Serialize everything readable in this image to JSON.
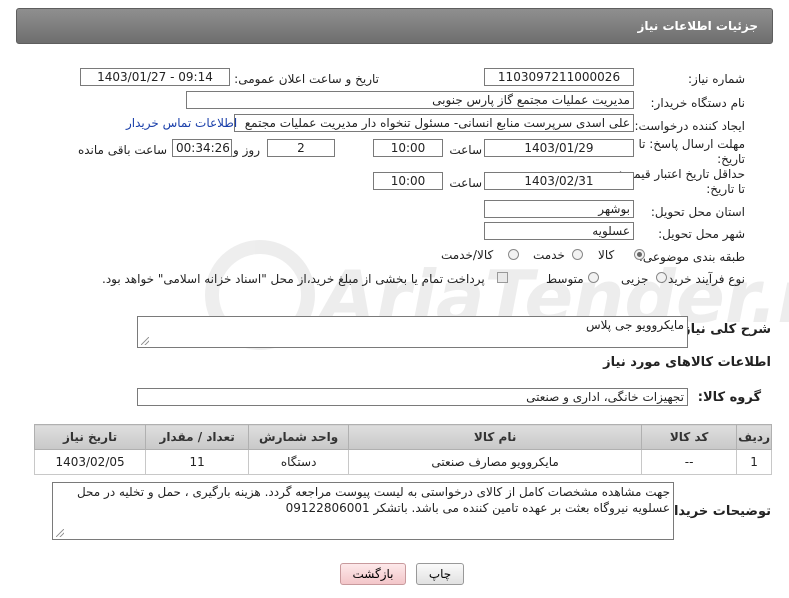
{
  "header": {
    "title": "جزئیات اطلاعات نیاز"
  },
  "form": {
    "need_number_label": "شماره نیاز:",
    "need_number": "1103097211000026",
    "announce_label": "تاریخ و ساعت اعلان عمومی:",
    "announce_value": "1403/01/27 - 09:14",
    "buyer_label": "نام دستگاه خریدار:",
    "buyer_value": "مدیریت عملیات مجتمع گاز پارس جنوبی",
    "creator_label": "ایجاد کننده درخواست:",
    "creator_value": "علی اسدی سرپرست منابع انسانی- مسئول تنخواه دار  مدیریت عملیات مجتمع",
    "contact_link": "اطلاعات تماس خریدار",
    "reply_deadline_label": "مهلت ارسال پاسخ: تا تاریخ:",
    "reply_date": "1403/01/29",
    "time_label": "ساعت",
    "reply_time": "10:00",
    "days_value": "2",
    "days_label": "روز و",
    "remaining_time": "00:34:26",
    "remaining_label": "ساعت باقی مانده",
    "price_validity_label": "حداقل تاریخ اعتبار قیمت: تا تاریخ:",
    "price_date": "1403/02/31",
    "price_time": "10:00",
    "province_label": "استان محل تحویل:",
    "province_value": "بوشهر",
    "city_label": "شهر محل تحویل:",
    "city_value": "عسلویه",
    "category_label": "طبقه بندی موضوعی:",
    "category_options": [
      "کالا",
      "خدمت",
      "کالا/خدمت"
    ],
    "category_selected": "کالا",
    "process_label": "نوع فرآیند خرید :",
    "process_options": [
      "جزیی",
      "متوسط"
    ],
    "process_selected": "جزیی",
    "payment_note": "پرداخت تمام یا بخشی از مبلغ خرید،از محل \"اسناد خزانه اسلامی\" خواهد بود.",
    "description_label": "شرح کلی نیاز:",
    "description_value": "مایکروویو جی پلاس",
    "goods_info_title": "اطلاعات کالاهای مورد نیاز",
    "goods_group_label": "گروه کالا:",
    "goods_group_value": "تجهیزات خانگی، اداری و صنعتی"
  },
  "table": {
    "headers": [
      "ردیف",
      "کد کالا",
      "نام کالا",
      "واحد شمارش",
      "تعداد / مقدار",
      "تاریخ نیاز"
    ],
    "rows": [
      [
        "1",
        "--",
        "مایکروویو مصارف صنعتی",
        "دستگاه",
        "11",
        "1403/02/05"
      ]
    ]
  },
  "buyer_notes": {
    "label": "توضیحات خریدار:",
    "text": "جهت مشاهده مشخصات کامل از کالای درخواستی به لیست پیوست مراجعه گردد. هزینه بارگیری ، حمل و تخلیه در محل عسلویه نیروگاه بعثت بر عهده تامین کننده می باشد. باتشکر 09122806001"
  },
  "buttons": {
    "print": "چاپ",
    "back": "بازگشت"
  },
  "watermark": {
    "text": "AriaTender.net"
  }
}
